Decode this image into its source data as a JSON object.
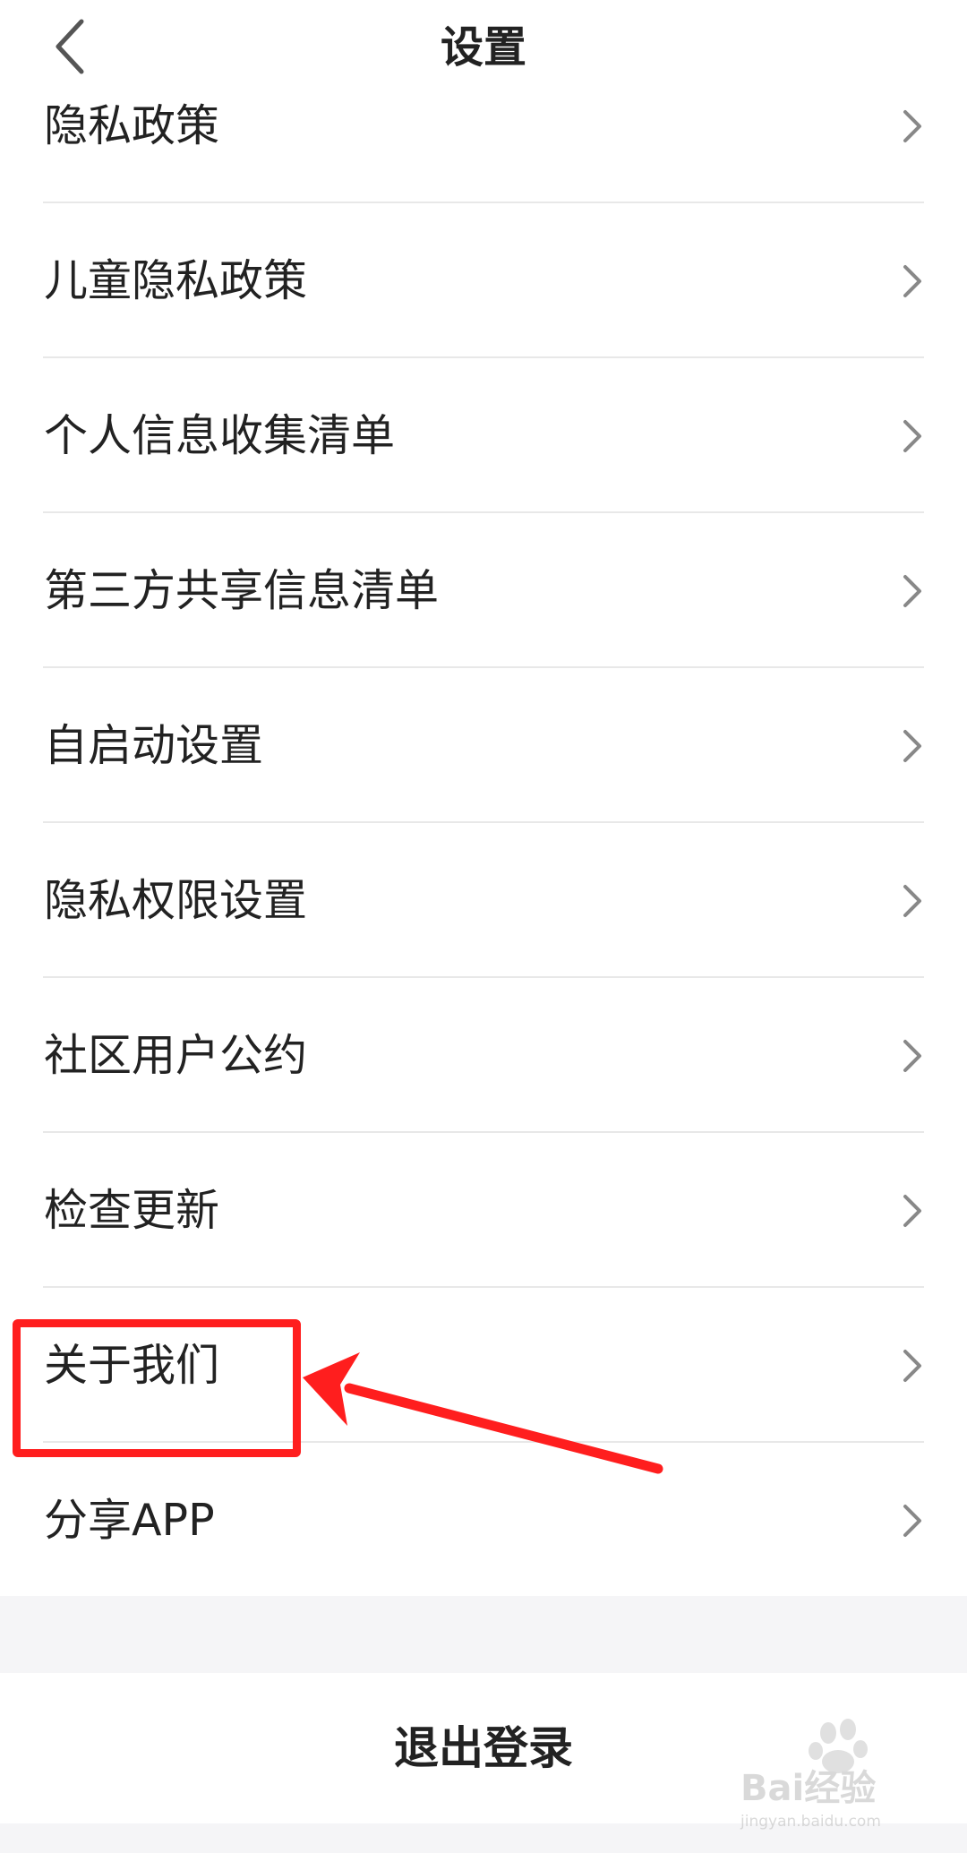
{
  "header": {
    "title": "设置"
  },
  "menu": {
    "items": [
      {
        "label": "隐私政策"
      },
      {
        "label": "儿童隐私政策"
      },
      {
        "label": "个人信息收集清单"
      },
      {
        "label": "第三方共享信息清单"
      },
      {
        "label": "自启动设置"
      },
      {
        "label": "隐私权限设置"
      },
      {
        "label": "社区用户公约"
      },
      {
        "label": "检查更新"
      },
      {
        "label": "关于我们"
      },
      {
        "label": "分享APP"
      }
    ]
  },
  "logout": {
    "label": "退出登录"
  },
  "watermark": {
    "brand": "Bai经验",
    "url": "jingyan.baidu.com"
  },
  "colors": {
    "highlight": "#ff1e1e",
    "divider": "#e8e8e8",
    "text": "#222222",
    "background_gray": "#f5f5f7"
  },
  "icons": {
    "back": "chevron-left-icon",
    "row": "chevron-right-icon"
  }
}
